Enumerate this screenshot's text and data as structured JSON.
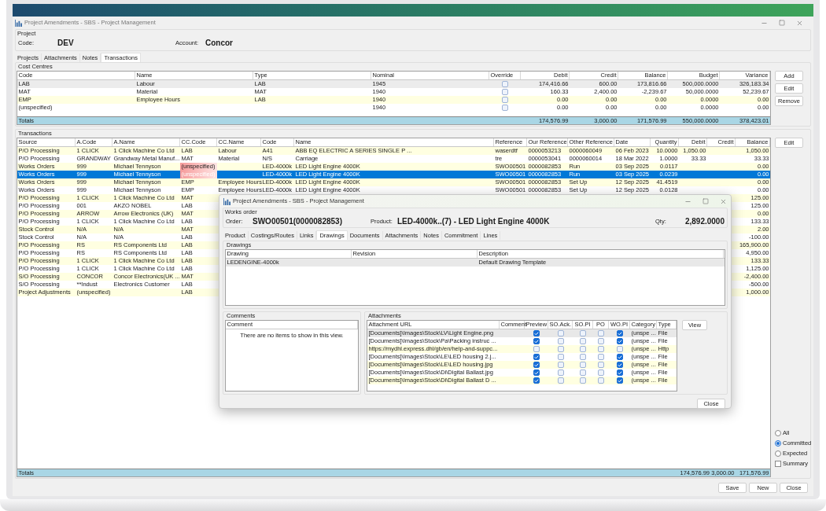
{
  "window": {
    "title": "Project Amendments - SBS - Project Management"
  },
  "project": {
    "group_label": "Project",
    "code_label": "Code:",
    "code": "DEV",
    "account_label": "Account:",
    "account": "Concor"
  },
  "tabs": [
    {
      "label": "Projects",
      "selected": false
    },
    {
      "label": "Attachments",
      "selected": false
    },
    {
      "label": "Notes",
      "selected": false
    },
    {
      "label": "Transactions",
      "selected": true
    }
  ],
  "cost_centres": {
    "title": "Cost Centres",
    "columns": [
      "Code",
      "Name",
      "Type",
      "Nominal",
      "Override",
      "Debit",
      "Credit",
      "Balance",
      "Budget",
      "Variance"
    ],
    "rows": [
      {
        "code": "LAB",
        "name": "Labour",
        "type": "LAB",
        "nominal": "1945",
        "override": false,
        "debit": "174,416.66",
        "credit": "600.00",
        "balance": "173,816.66",
        "budget": "500,000.0000",
        "variance": "326,183.34",
        "selected": true
      },
      {
        "code": "MAT",
        "name": "Material",
        "type": "MAT",
        "nominal": "1940",
        "override": false,
        "debit": "160.33",
        "credit": "2,400.00",
        "balance": "-2,239.67",
        "budget": "50,000.0000",
        "variance": "52,239.67",
        "selected": false
      },
      {
        "code": "EMP",
        "name": "Employee Hours",
        "type": "LAB",
        "nominal": "1940",
        "override": false,
        "debit": "0.00",
        "credit": "0.00",
        "balance": "0.00",
        "budget": "0.0000",
        "variance": "0.00",
        "selected": false
      },
      {
        "code": "(unspecified)",
        "nominal": "1940",
        "override": false,
        "debit": "0.00",
        "credit": "0.00",
        "balance": "0.00",
        "budget": "0.0000",
        "variance": "0.00",
        "selected": false
      }
    ],
    "totals": {
      "code": "Totals",
      "debit": "174,576.99",
      "credit": "3,000.00",
      "balance": "171,576.99",
      "budget": "550,000.0000",
      "variance": "378,423.01"
    },
    "buttons": [
      "Add",
      "Edit",
      "Remove"
    ]
  },
  "transactions": {
    "title": "Transactions",
    "columns": [
      "Source",
      "A.Code",
      "A.Name",
      "CC.Code",
      "CC.Name",
      "Code",
      "Name",
      "Reference",
      "Our Reference",
      "Other Reference",
      "Date",
      "Quantity",
      "Debit",
      "Credit",
      "Balance"
    ],
    "rows": [
      {
        "source": "P/O Processing",
        "a_code": "1 CLICK",
        "a_name": "1 Click Machine Co Ltd",
        "cc_code": "LAB",
        "cc_name": "Labour",
        "code": "A41",
        "name": "ABB EQ ELECTRIC A SERIES SINGLE P ...",
        "reference": "waserdtf",
        "our_reference": "0000053213",
        "other_reference": "0000060049",
        "date": "06 Feb 2023",
        "quantity": "10.0000",
        "debit": "1,050.00",
        "balance": "1,050.00",
        "selected": false,
        "flagged": false
      },
      {
        "source": "P/O Processing",
        "a_code": "GRANDWAY",
        "a_name": "Grandway Metal Manuf...",
        "cc_code": "MAT",
        "cc_name": "Material",
        "code": "N/S",
        "name": "Carriage",
        "reference": "tre",
        "our_reference": "0000053041",
        "other_reference": "0000060014",
        "date": "18 Mar 2022",
        "quantity": "1.0000",
        "debit": "33.33",
        "balance": "33.33",
        "selected": false,
        "flagged": false
      },
      {
        "source": "Works Orders",
        "a_code": "999",
        "a_name": "Michael Tennyson",
        "cc_code": "(unspecified)",
        "code": "LED-4000k",
        "name": "LED Light Engine 4000K",
        "reference": "SWO00501",
        "our_reference": "0000082853",
        "other_reference": "Run",
        "date": "03 Sep 2025",
        "quantity": "0.0117",
        "balance": "0.00",
        "selected": false,
        "flagged": true
      },
      {
        "source": "Works Orders",
        "a_code": "999",
        "a_name": "Michael Tennyson",
        "cc_code": "(unspecified)",
        "code": "LED-4000k",
        "name": "LED Light Engine 4000K",
        "reference": "SWO00501",
        "our_reference": "0000082853",
        "other_reference": "Run",
        "date": "03 Sep 2025",
        "quantity": "0.0239",
        "balance": "0.00",
        "selected": true,
        "flagged": true
      },
      {
        "source": "Works Orders",
        "a_code": "999",
        "a_name": "Michael Tennyson",
        "cc_code": "EMP",
        "cc_name": "Employee Hours",
        "code": "LED-4000k",
        "name": "LED Light Engine 4000K",
        "reference": "SWO00501",
        "our_reference": "0000082853",
        "other_reference": "Set Up",
        "date": "12 Sep 2025",
        "quantity": "41.4519",
        "balance": "0.00",
        "selected": false,
        "flagged": false
      },
      {
        "source": "Works Orders",
        "a_code": "999",
        "a_name": "Michael Tennyson",
        "cc_code": "EMP",
        "cc_name": "Employee Hours",
        "code": "LED-4000k",
        "name": "LED Light Engine 4000K",
        "reference": "SWO00501",
        "our_reference": "0000082853",
        "other_reference": "Set Up",
        "date": "12 Sep 2025",
        "quantity": "0.0128",
        "balance": "0.00",
        "selected": false,
        "flagged": false
      },
      {
        "source": "P/O Processing",
        "a_code": "1 CLICK",
        "a_name": "1 Click Machine Co Ltd",
        "cc_code": "MAT",
        "balance": "125.00",
        "selected": false,
        "flagged": false
      },
      {
        "source": "P/O Processing",
        "a_code": "001",
        "a_name": "AKZO NOBEL",
        "cc_code": "LAB",
        "balance": "125.00",
        "selected": false,
        "flagged": false
      },
      {
        "source": "P/O Processing",
        "a_code": "ARROW",
        "a_name": "Arrow Electronics (UK)",
        "cc_code": "MAT",
        "balance": "0.00",
        "selected": false,
        "flagged": false
      },
      {
        "source": "P/O Processing",
        "a_code": "1 CLICK",
        "a_name": "1 Click Machine Co Ltd",
        "cc_code": "LAB",
        "balance": "133.33",
        "selected": false,
        "flagged": false
      },
      {
        "source": "Stock Control",
        "a_code": "N/A",
        "a_name": "N/A",
        "cc_code": "MAT",
        "balance": "2.00",
        "selected": false,
        "flagged": false
      },
      {
        "source": "Stock Control",
        "a_code": "N/A",
        "a_name": "N/A",
        "cc_code": "LAB",
        "balance": "-100.00",
        "selected": false,
        "flagged": false
      },
      {
        "source": "P/O Processing",
        "a_code": "RS",
        "a_name": "RS Components Ltd",
        "cc_code": "LAB",
        "balance": "165,900.00",
        "selected": false,
        "flagged": false
      },
      {
        "source": "P/O Processing",
        "a_code": "RS",
        "a_name": "RS Components Ltd",
        "cc_code": "LAB",
        "balance": "4,950.00",
        "selected": false,
        "flagged": false
      },
      {
        "source": "P/O Processing",
        "a_code": "1 CLICK",
        "a_name": "1 Click Machine Co Ltd",
        "cc_code": "LAB",
        "balance": "133.33",
        "selected": false,
        "flagged": false
      },
      {
        "source": "P/O Processing",
        "a_code": "1 CLICK",
        "a_name": "1 Click Machine Co Ltd",
        "cc_code": "LAB",
        "balance": "1,125.00",
        "selected": false,
        "flagged": false
      },
      {
        "source": "S/O Processing",
        "a_code": "CONCOR",
        "a_name": "Concor Electronics(UK ...",
        "cc_code": "MAT",
        "balance": "-2,400.00",
        "selected": false,
        "flagged": false
      },
      {
        "source": "S/O Processing",
        "a_code": "**Indust",
        "a_name": "Electronics Customer",
        "cc_code": "LAB",
        "balance": "-500.00",
        "selected": false,
        "flagged": false
      },
      {
        "source": "Project Adjustments",
        "a_code": "(unspecified)",
        "cc_code": "LAB",
        "balance": "1,000.00",
        "selected": false,
        "flagged": false
      }
    ],
    "totals": {
      "source": "Totals",
      "debit": "174,576.99",
      "credit": "3,000.00",
      "balance": "171,576.99"
    },
    "buttons": [
      "Edit"
    ]
  },
  "filter_options": [
    {
      "label": "All",
      "selected": false
    },
    {
      "label": "Committed",
      "selected": true
    },
    {
      "label": "Expected",
      "selected": false
    }
  ],
  "summary": {
    "label": "Summary",
    "checked": false
  },
  "footer_buttons": [
    "Save",
    "New",
    "Close"
  ],
  "dialog": {
    "title": "Project Amendments - SBS - Project Management",
    "group_label": "Works order",
    "order_label": "Order:",
    "order": "SWO00501(0000082853)",
    "product_label": "Product:",
    "product": "LED-4000k..(7) - LED Light Engine 4000K",
    "qty_label": "Qty:",
    "qty": "2,892.0000",
    "tabs": [
      {
        "label": "Product",
        "selected": false
      },
      {
        "label": "Costings/Routes",
        "selected": false
      },
      {
        "label": "Links",
        "selected": false
      },
      {
        "label": "Drawings",
        "selected": true
      },
      {
        "label": "Documents",
        "selected": false
      },
      {
        "label": "Attachments",
        "selected": false
      },
      {
        "label": "Notes",
        "selected": false
      },
      {
        "label": "Commitment",
        "selected": false
      },
      {
        "label": "Lines",
        "selected": false
      }
    ],
    "drawings": {
      "title": "Drawings",
      "columns": [
        "Drawing",
        "Revision",
        "Description"
      ],
      "rows": [
        {
          "drawing": "LEDENGINE-4000k",
          "description": "Default Drawing Template",
          "selected": true
        }
      ]
    },
    "comments": {
      "title": "Comments",
      "columns": [
        "Comment"
      ],
      "empty_message": "There are no items to show in this view."
    },
    "attachments": {
      "title": "Attachments",
      "columns": [
        "Attachment URL",
        "Comment",
        "Preview",
        "SO.Ack.",
        "SO.PI",
        "PO",
        "WO.PI",
        "Category",
        "Type"
      ],
      "rows": [
        {
          "url": "[Documents]\\Images\\Stock\\LV\\Light Engine.png",
          "preview": true,
          "so_ack": false,
          "so_pi": false,
          "po": false,
          "wo_pi": true,
          "category": "(unspe ...",
          "type": "File",
          "selected": true
        },
        {
          "url": "[Documents]\\Images\\Stock\\Pa\\Packing instruc ...",
          "preview": true,
          "so_ack": false,
          "so_pi": false,
          "po": false,
          "wo_pi": true,
          "category": "(unspe ...",
          "type": "File",
          "selected": false
        },
        {
          "url": "https://mydhl.express.dhl/gb/en/help-and-suppc...",
          "preview": false,
          "so_ack": false,
          "so_pi": false,
          "po": false,
          "wo_pi": false,
          "category": "(unspe ...",
          "type": "Http",
          "selected": false
        },
        {
          "url": "[Documents]\\Images\\Stock\\LE\\LED housing 2.j...",
          "preview": true,
          "so_ack": false,
          "so_pi": false,
          "po": false,
          "wo_pi": true,
          "category": "(unspe ...",
          "type": "File",
          "selected": false
        },
        {
          "url": "[Documents]\\Images\\Stock\\LE\\LED housing.jpg",
          "preview": true,
          "so_ack": false,
          "so_pi": false,
          "po": false,
          "wo_pi": true,
          "category": "(unspe ...",
          "type": "File",
          "selected": false
        },
        {
          "url": "[Documents]\\Images\\Stock\\Di\\Digital Ballast.jpg",
          "preview": true,
          "so_ack": false,
          "so_pi": false,
          "po": false,
          "wo_pi": true,
          "category": "(unspe ...",
          "type": "File",
          "selected": false
        },
        {
          "url": "[Documents]\\Images\\Stock\\Di\\Digital Ballast D ...",
          "preview": true,
          "so_ack": false,
          "so_pi": false,
          "po": false,
          "wo_pi": true,
          "category": "(unspe ...",
          "type": "File",
          "selected": false
        }
      ],
      "view_button": "View"
    },
    "close_button": "Close"
  }
}
